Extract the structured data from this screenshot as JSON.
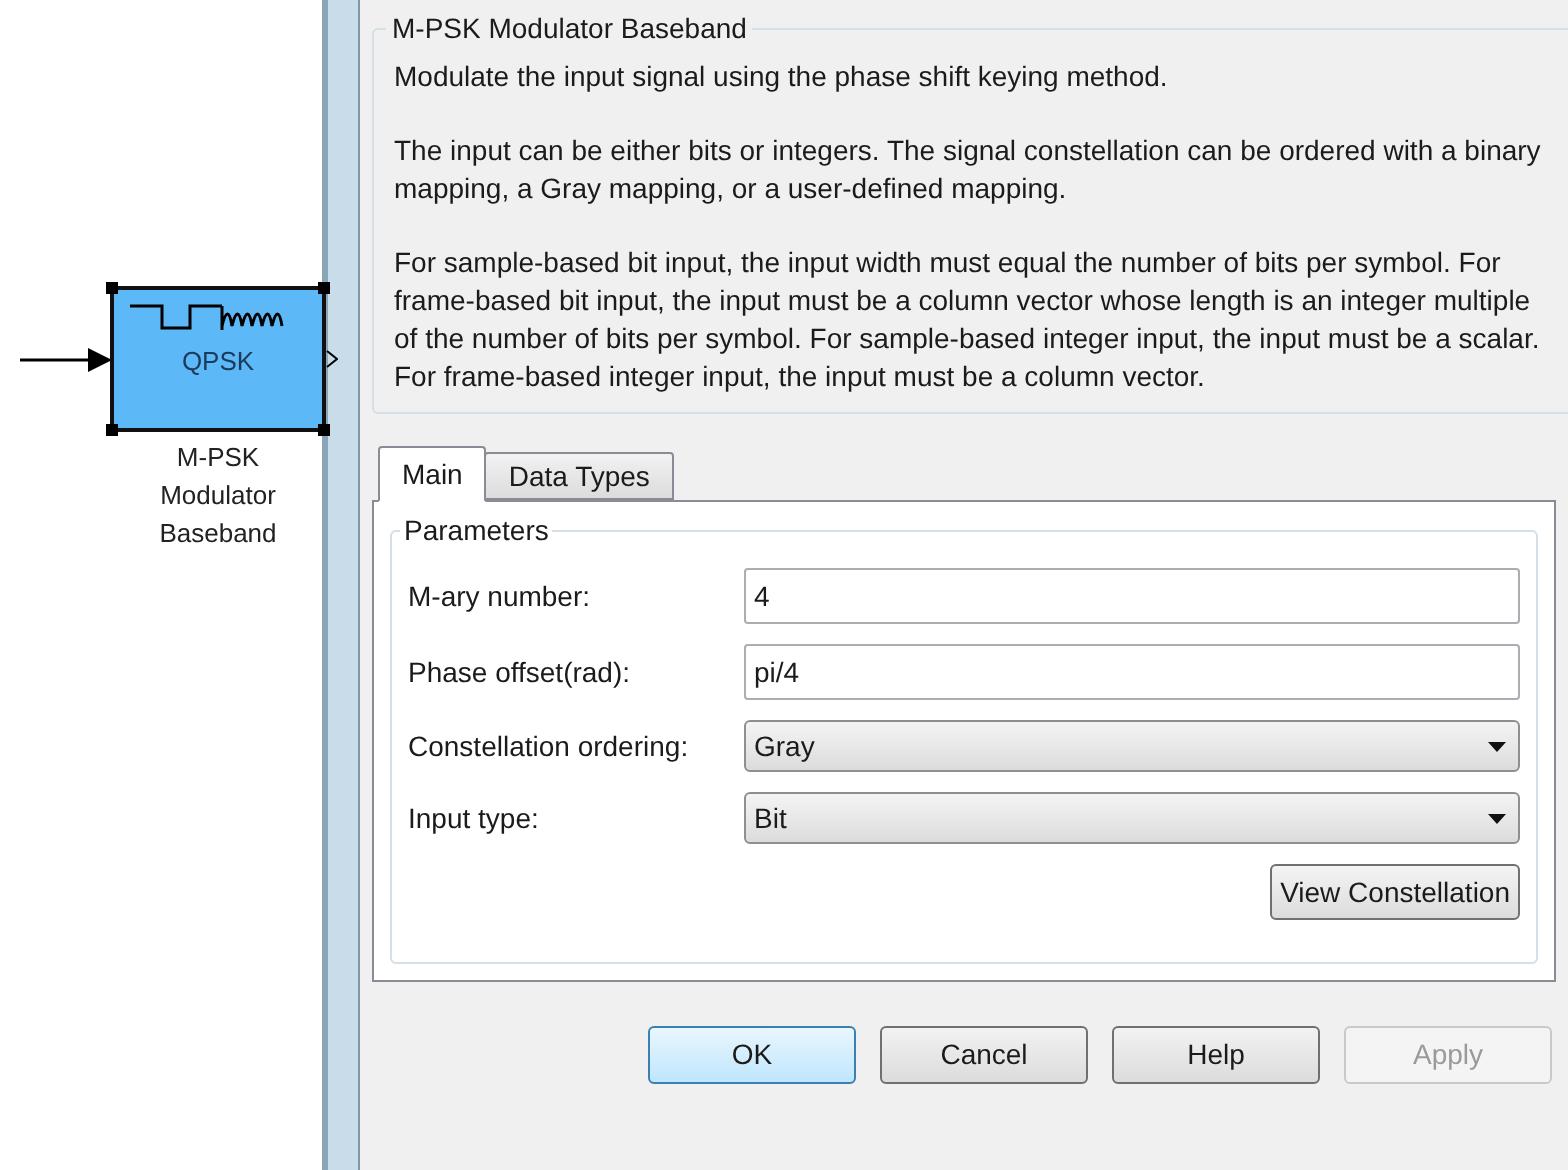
{
  "block": {
    "icon_text": "QPSK",
    "name_lines": [
      "M-PSK",
      "Modulator",
      "Baseband"
    ],
    "selected": true
  },
  "dialog": {
    "title": "M-PSK Modulator Baseband",
    "description": [
      "Modulate the input signal using the phase shift keying method.",
      "The input can be either bits or integers. The signal constellation can be ordered with a binary mapping, a Gray mapping, or a user-defined mapping.",
      "For sample-based bit input, the input width must equal the number of bits per symbol. For frame-based bit input, the input must be a column vector whose length is an integer multiple of the number of bits per symbol. For sample-based integer input, the input must be a scalar. For frame-based integer input, the input must be a column vector."
    ]
  },
  "tabs": [
    {
      "label": "Main",
      "selected": true
    },
    {
      "label": "Data Types",
      "selected": false
    }
  ],
  "parameters": {
    "title": "Parameters",
    "fields": [
      {
        "kind": "edit",
        "label": "M-ary number:",
        "value": "4"
      },
      {
        "kind": "edit",
        "label": "Phase offset(rad):",
        "value": "pi/4"
      },
      {
        "kind": "popup",
        "label": "Constellation ordering:",
        "value": "Gray"
      },
      {
        "kind": "popup",
        "label": "Input type:",
        "value": "Bit"
      }
    ],
    "action": "View Constellation"
  },
  "buttons": [
    {
      "label": "OK",
      "default": true,
      "disabled": false
    },
    {
      "label": "Cancel",
      "default": false,
      "disabled": false
    },
    {
      "label": "Help",
      "default": false,
      "disabled": false
    },
    {
      "label": "Apply",
      "default": false,
      "disabled": true
    }
  ]
}
